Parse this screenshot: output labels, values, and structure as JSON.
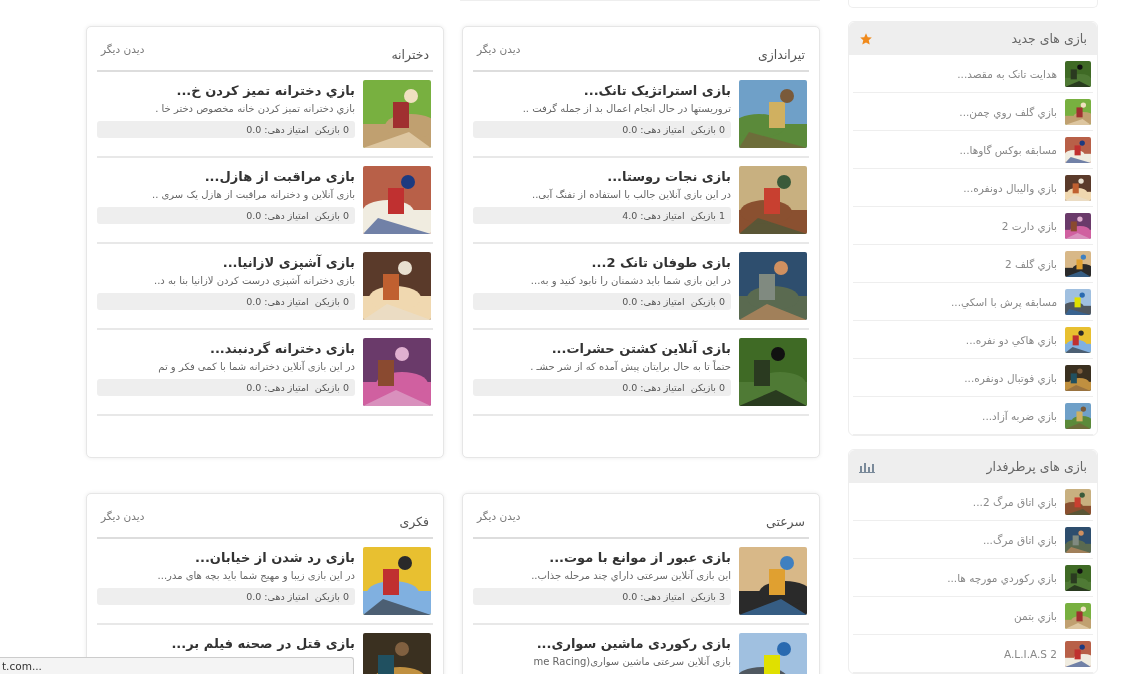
{
  "categories": [
    {
      "title": "تیراندازی",
      "more": "دیدن دیگر",
      "games": [
        {
          "title": "بازی استراتژیک تانک...",
          "description": "تروریستها در حال انجام اعمال بد از جمله گرفت ..",
          "players": "0 بازیکن",
          "rating": "امتیاز دهی: 0.0"
        },
        {
          "title": "بازی نجات روستا...",
          "description": "در این بازی آنلاین جالب با استفاده از تفنگ آبی..",
          "players": "1 بازیکن",
          "rating": "امتیاز دهی: 4.0"
        },
        {
          "title": "بازی طوفان تانک 2...",
          "description": "در این بازی شما باید دشمنان را نابود کنید و به...",
          "players": "0 بازیکن",
          "rating": "امتیاز دهی: 0.0"
        },
        {
          "title": "بازی آنلاین کشتن حشرات...",
          "description": "حتماً تا به حال برایتان پیش آمده که از شر حشـ .",
          "players": "0 بازیکن",
          "rating": "امتیاز دهی: 0.0"
        }
      ]
    },
    {
      "title": "دخترانه",
      "more": "دیدن دیگر",
      "games": [
        {
          "title": "بازي دخترانه تمیز کردن خ...",
          "description": "بازي دخترانه تمیز کردن خانه مخصوص دختر خا .",
          "players": "0 بازیکن",
          "rating": "امتیاز دهی: 0.0"
        },
        {
          "title": "بازی مراقبت از هازل...",
          "description": "بازی آنلاین و دخترانه مراقبت از هازل یک سری ..",
          "players": "0 بازیکن",
          "rating": "امتیاز دهی: 0.0"
        },
        {
          "title": "بازی آشپزی لازانیا...",
          "description": "بازی دخترانه آشپزی درست کردن لازانیا بنا به د..",
          "players": "0 بازیکن",
          "rating": "امتیاز دهی: 0.0"
        },
        {
          "title": "بازی دخترانه گردنبند...",
          "description": "در این بازی آنلاین دخترانه شما با کمی فکر و تم",
          "players": "0 بازیکن",
          "rating": "امتیاز دهی: 0.0"
        }
      ]
    },
    {
      "title": "سرعتی",
      "more": "دیدن دیگر",
      "games": [
        {
          "title": "بازی عبور از موانع با موت...",
          "description": "این بازی آنلاین سرعتی داراي چند مرحله جذاب..",
          "players": "3 بازیکن",
          "rating": "امتیاز دهی: 0.0"
        },
        {
          "title": "بازی رکوردی ماشین سواری...",
          "description": "بازی آنلاین سرعتی ماشین سواری(me Racing"
        }
      ]
    },
    {
      "title": "فکری",
      "more": "دیدن دیگر",
      "games": [
        {
          "title": "بازی رد شدن از خیابان...",
          "description": "در این بازی زیبا و مهیج شما باید بچه های مدر...",
          "players": "0 بازیکن",
          "rating": "امتیاز دهی: 0.0"
        },
        {
          "title": "بازی قتل در صحنه فیلم بر..."
        }
      ]
    }
  ],
  "sidebar": [
    {
      "title": "بازی های جدید",
      "kind": "star",
      "items": [
        "هدایت تانک به مقصد...",
        "بازي گلف روي چمن...",
        "مسابقه بوكس گاوها...",
        "بازي واليبال دونفره...",
        "بازي دارت 2",
        "بازي گلف 2",
        "مسابقه پرش با اسكي...",
        "بازي هاكي دو نفره...",
        "بازي فوتبال دونفره...",
        "بازي ضربه آزاد..."
      ]
    },
    {
      "title": "بازی های پرطرفدار",
      "kind": "chart",
      "items": [
        "بازي اتاق مرگ 2...",
        "بازي اتاق مرگ...",
        "بازي ركوردي مورچه ها...",
        "بازي بتمن",
        "A.L.I.A.S 2"
      ]
    }
  ],
  "status_bubble": "t.com..."
}
